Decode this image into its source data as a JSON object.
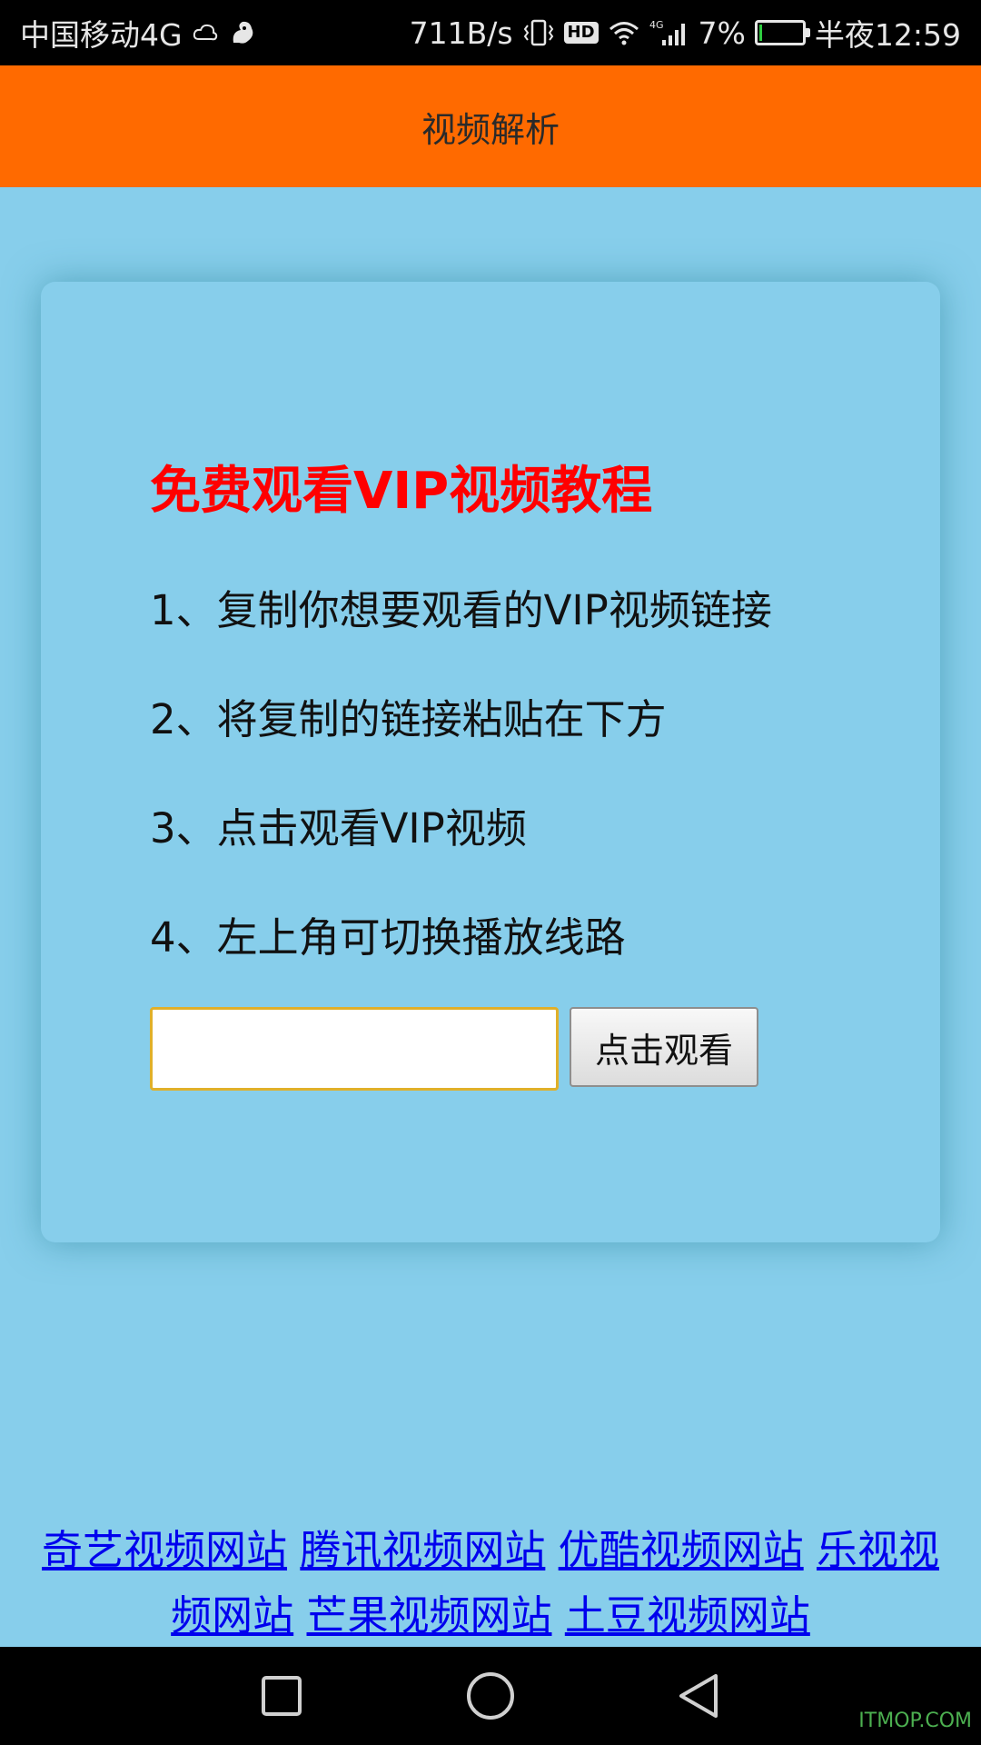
{
  "status_bar": {
    "carrier": "中国移动4G",
    "speed": "711B/s",
    "hd": "HD",
    "network": "4G",
    "battery": "7%",
    "time": "半夜12:59",
    "battery_level": 0.07
  },
  "header": {
    "title": "视频解析",
    "color": "#ff6a00"
  },
  "card": {
    "title": "免费观看VIP视频教程",
    "steps": [
      "1、复制你想要观看的VIP视频链接",
      "2、将复制的链接粘贴在下方",
      "3、点击观看VIP视频",
      "4、左上角可切换播放线路"
    ],
    "input_value": "",
    "input_placeholder": "",
    "button_label": "点击观看"
  },
  "links": [
    "奇艺视频网站",
    "腾讯视频网站",
    "优酷视频网站",
    "乐视视频网站",
    "芒果视频网站",
    "土豆视频网站"
  ],
  "watermark": "ITMOP.COM",
  "colors": {
    "background": "#87ceeb",
    "title_red": "#ff0000",
    "link_blue": "#0000ee"
  }
}
